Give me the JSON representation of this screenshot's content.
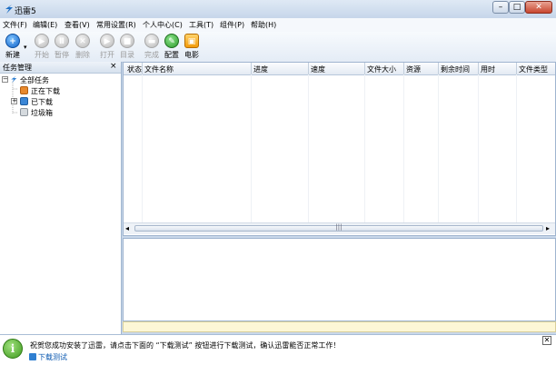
{
  "window": {
    "title": "迅雷5",
    "controls": {
      "minimize": "–",
      "maximize": "□",
      "close": "✕"
    }
  },
  "menu": [
    "文件(F)",
    "编辑(E)",
    "查看(V)",
    "常用设置(R)",
    "个人中心(C)",
    "工具(T)",
    "组件(P)",
    "帮助(H)"
  ],
  "toolbar": {
    "new_dropdown": "▾",
    "buttons": [
      {
        "label": "新建",
        "icon": "new-icon",
        "glyph": "+",
        "enabled": true
      },
      {
        "label": "开始",
        "icon": "play-icon",
        "glyph": "▶",
        "enabled": false
      },
      {
        "label": "暂停",
        "icon": "pause-icon",
        "glyph": "Ⅱ",
        "enabled": false
      },
      {
        "label": "删除",
        "icon": "delete-icon",
        "glyph": "✕",
        "enabled": false
      },
      {
        "label": "打开",
        "icon": "open-icon",
        "glyph": "▶",
        "enabled": false
      },
      {
        "label": "目录",
        "icon": "folder-icon",
        "glyph": "■",
        "enabled": false
      },
      {
        "label": "完成",
        "icon": "complete-icon",
        "glyph": "▬",
        "enabled": false
      },
      {
        "label": "配置",
        "icon": "config-icon",
        "glyph": "✎",
        "enabled": true
      },
      {
        "label": "电影",
        "icon": "movie-icon",
        "glyph": "▣",
        "enabled": true
      }
    ]
  },
  "left_panel": {
    "title": "任务管理",
    "close": "×",
    "tree": [
      {
        "label": "全部任务",
        "icon": "all-tasks-icon",
        "expander": "−",
        "color": "#2f7fd1"
      },
      {
        "label": "正在下载",
        "icon": "downloading-icon",
        "expander": "",
        "color": "#e8892d"
      },
      {
        "label": "已下载",
        "icon": "downloaded-icon",
        "expander": "+",
        "color": "#3a86d6"
      },
      {
        "label": "垃圾箱",
        "icon": "trash-icon",
        "expander": "",
        "color": "#9aa3ad"
      }
    ]
  },
  "task_list": {
    "columns": [
      "状态",
      "文件名称",
      "进度",
      "速度",
      "文件大小",
      "资源",
      "剩余时间",
      "用时",
      "文件类型"
    ],
    "rows": [],
    "hscroll": {
      "left": "◂",
      "right": "▸",
      "grip": "|||"
    }
  },
  "notification": {
    "text": "祝贺您成功安装了迅雷，请点击下面的 “下载测试” 按钮进行下载测试，确认迅雷能否正常工作！",
    "link": "下载测试",
    "close": "✕",
    "icon_glyph": "i"
  }
}
